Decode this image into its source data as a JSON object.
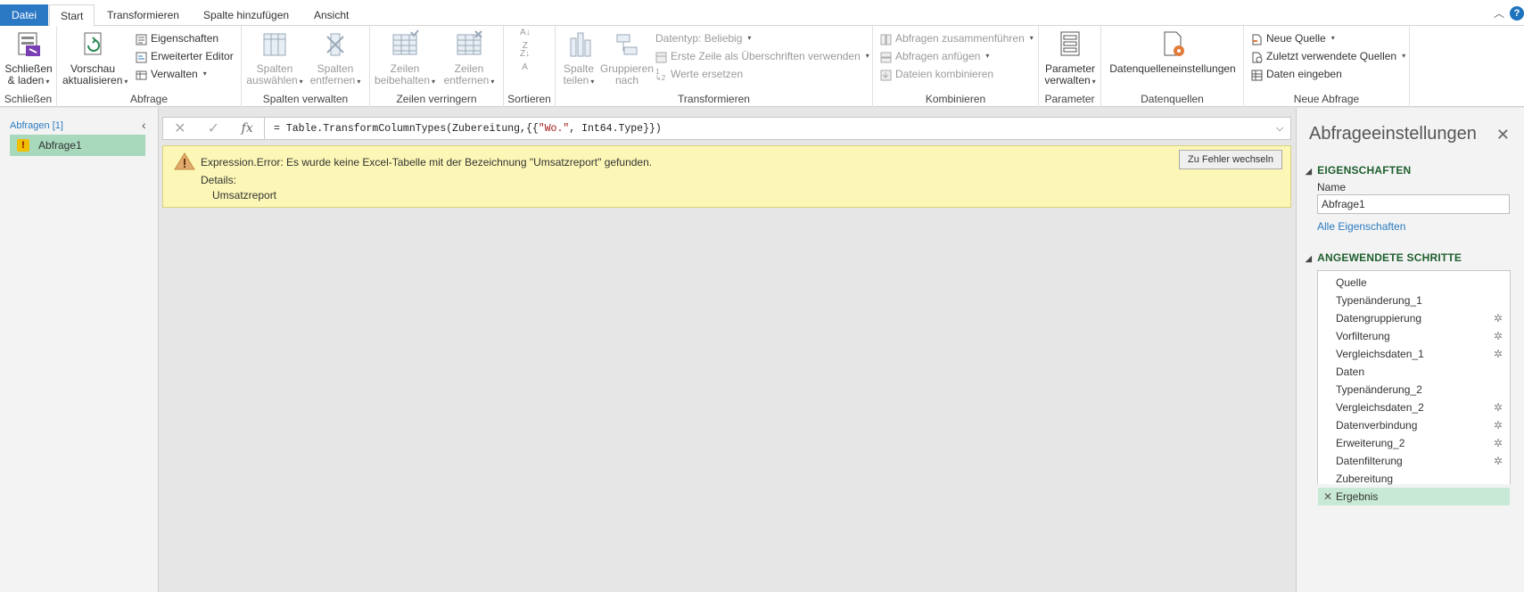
{
  "tabs": {
    "file": "Datei",
    "start": "Start",
    "transform": "Transformieren",
    "addcol": "Spalte hinzufügen",
    "view": "Ansicht"
  },
  "ribbon": {
    "close": {
      "label": "Schließen",
      "btn1": "Schließen",
      "btn2": "& laden"
    },
    "query": {
      "label": "Abfrage",
      "refresh1": "Vorschau",
      "refresh2": "aktualisieren",
      "props": "Eigenschaften",
      "adv": "Erweiterter Editor",
      "manage": "Verwalten"
    },
    "cols": {
      "label": "Spalten verwalten",
      "sel1": "Spalten",
      "sel2": "auswählen",
      "rem1": "Spalten",
      "rem2": "entfernen"
    },
    "rows": {
      "label": "Zeilen verringern",
      "keep1": "Zeilen",
      "keep2": "beibehalten",
      "rem1": "Zeilen",
      "rem2": "entfernen"
    },
    "sort": {
      "label": "Sortieren"
    },
    "transform": {
      "label": "Transformieren",
      "split1": "Spalte",
      "split2": "teilen",
      "group1": "Gruppieren",
      "group2": "nach",
      "dtype": "Datentyp: Beliebig",
      "firstrow": "Erste Zeile als Überschriften verwenden",
      "replace": "Werte ersetzen"
    },
    "combine": {
      "label": "Kombinieren",
      "merge": "Abfragen zusammenführen",
      "append": "Abfragen anfügen",
      "files": "Dateien kombinieren"
    },
    "params": {
      "label": "Parameter",
      "btn1": "Parameter",
      "btn2": "verwalten"
    },
    "sources": {
      "label": "Datenquellen",
      "btn": "Datenquelleneinstellungen"
    },
    "newq": {
      "label": "Neue Abfrage",
      "new": "Neue Quelle",
      "recent": "Zuletzt verwendete Quellen",
      "enter": "Daten eingeben"
    }
  },
  "queries": {
    "header": "Abfragen [1]",
    "item": "Abfrage1"
  },
  "formula": {
    "prefix": "= Table.TransformColumnTypes(Zubereitung,{{",
    "str": "\"Wo.\"",
    "suffix": ", Int64.Type}})"
  },
  "error": {
    "message": "Expression.Error: Es wurde keine Excel-Tabelle mit der Bezeichnung \"Umsatzreport\" gefunden.",
    "details_label": "Details:",
    "detail": "Umsatzreport",
    "button": "Zu Fehler wechseln"
  },
  "settings": {
    "title": "Abfrageeinstellungen",
    "props_header": "EIGENSCHAFTEN",
    "name_label": "Name",
    "name_value": "Abfrage1",
    "all_props": "Alle Eigenschaften",
    "steps_header": "ANGEWENDETE SCHRITTE",
    "steps": [
      {
        "name": "Quelle",
        "gear": false
      },
      {
        "name": "Typenänderung_1",
        "gear": false
      },
      {
        "name": "Datengruppierung",
        "gear": true
      },
      {
        "name": "Vorfilterung",
        "gear": true
      },
      {
        "name": "Vergleichsdaten_1",
        "gear": true
      },
      {
        "name": "Daten",
        "gear": false
      },
      {
        "name": "Typenänderung_2",
        "gear": false
      },
      {
        "name": "Vergleichsdaten_2",
        "gear": true
      },
      {
        "name": "Datenverbindung",
        "gear": true
      },
      {
        "name": "Erweiterung_2",
        "gear": true
      },
      {
        "name": "Datenfilterung",
        "gear": true
      },
      {
        "name": "Zubereitung",
        "gear": false
      },
      {
        "name": "Ergebnis",
        "gear": false,
        "selected": true
      }
    ]
  },
  "colors": {
    "file_tab": "#2b78c5",
    "selected_green": "#a8d9bd",
    "error_bg": "#fcf7b6",
    "link": "#2b7bc0"
  }
}
